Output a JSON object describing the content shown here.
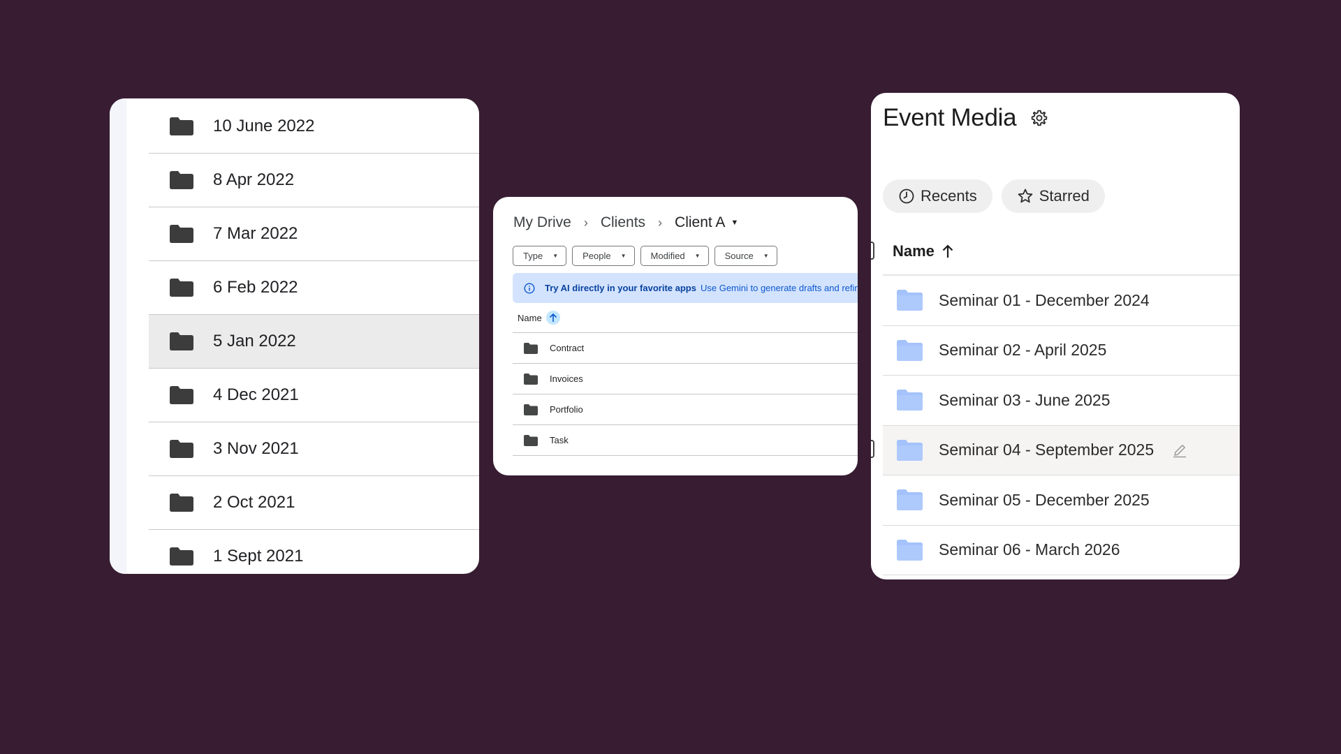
{
  "left_panel": {
    "folders": [
      {
        "label": "10 June 2022"
      },
      {
        "label": "8 Apr 2022"
      },
      {
        "label": "7 Mar 2022"
      },
      {
        "label": "6 Feb 2022"
      },
      {
        "label": "5 Jan 2022"
      },
      {
        "label": "4 Dec 2021"
      },
      {
        "label": "3 Nov 2021"
      },
      {
        "label": "2 Oct 2021"
      },
      {
        "label": "1 Sept 2021"
      }
    ],
    "selected_index": 4
  },
  "middle_panel": {
    "breadcrumb": [
      "My Drive",
      "Clients",
      "Client A"
    ],
    "filters": [
      "Type",
      "People",
      "Modified",
      "Source"
    ],
    "banner": {
      "bold": "Try AI directly in your favorite apps",
      "text": "Use Gemini to generate drafts and refine"
    },
    "column_header": "Name",
    "folders": [
      "Contract",
      "Invoices",
      "Portfolio",
      "Task"
    ]
  },
  "right_panel": {
    "title": "Event Media",
    "tabs": [
      {
        "label": "Recents",
        "icon": "clock-icon"
      },
      {
        "label": "Starred",
        "icon": "star-icon"
      }
    ],
    "column_header": "Name",
    "folders": [
      "Seminar 01 - December 2024",
      "Seminar 02 - April 2025",
      "Seminar 03 - June 2025",
      "Seminar 04 - September 2025",
      "Seminar 05 - December 2025",
      "Seminar 06 - March 2026"
    ],
    "hover_index": 3
  },
  "colors": {
    "background": "#371c32",
    "dark_folder": "#3c3c3c",
    "light_folder": "#a4c2fb",
    "banner": "#d3e3fd",
    "accent_blue": "#0b57d0"
  }
}
